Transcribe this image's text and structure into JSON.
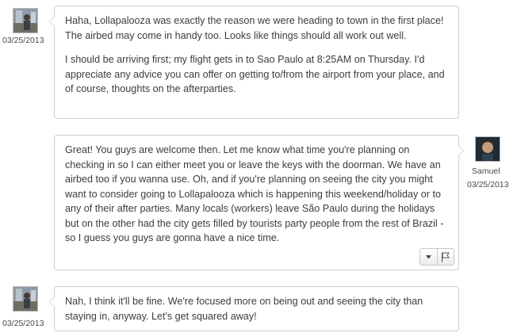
{
  "messages": [
    {
      "sender": "",
      "date": "03/25/2013",
      "paragraphs": [
        "Haha, Lollapalooza was exactly the reason we were heading to town in the first place! The airbed may come in handy too. Looks like things should all work out well.",
        "I should be arriving first; my flight gets in to Sao Paulo at 8:25AM on Thursday. I'd appreciate any advice you can offer on getting to/from the airport from your place, and of course, thoughts on the afterparties."
      ]
    },
    {
      "sender": "Samuel",
      "date": "03/25/2013",
      "paragraphs": [
        "Great! You guys are welcome then. Let me know what time you're planning on checking in so I can either meet you or leave the keys with the doorman. We have an airbed too if you wanna use. Oh, and if you're planning on seeing the city you might want to consider going to Lollapalooza which is happening this weekend/holiday or to any of their after parties. Many locals (workers) leave São Paulo during the holidays but on the other had the city gets filled by tourists party people from the rest of Brazil - so I guess you guys are gonna have a nice time."
      ]
    },
    {
      "sender": "",
      "date": "03/25/2013",
      "paragraphs": [
        "Nah, I think it'll be fine. We're focused more on being out and seeing the city than staying in, anyway. Let's get squared away!"
      ]
    }
  ],
  "icons": {
    "dropdown": "caret-down-icon",
    "flag": "flag-icon",
    "avatar_left": "user-photo-avatar",
    "avatar_right": "user-photo-avatar"
  },
  "colors": {
    "bubble_border": "#cfcfcf",
    "text": "#3c3c3c",
    "background": "#ffffff"
  }
}
